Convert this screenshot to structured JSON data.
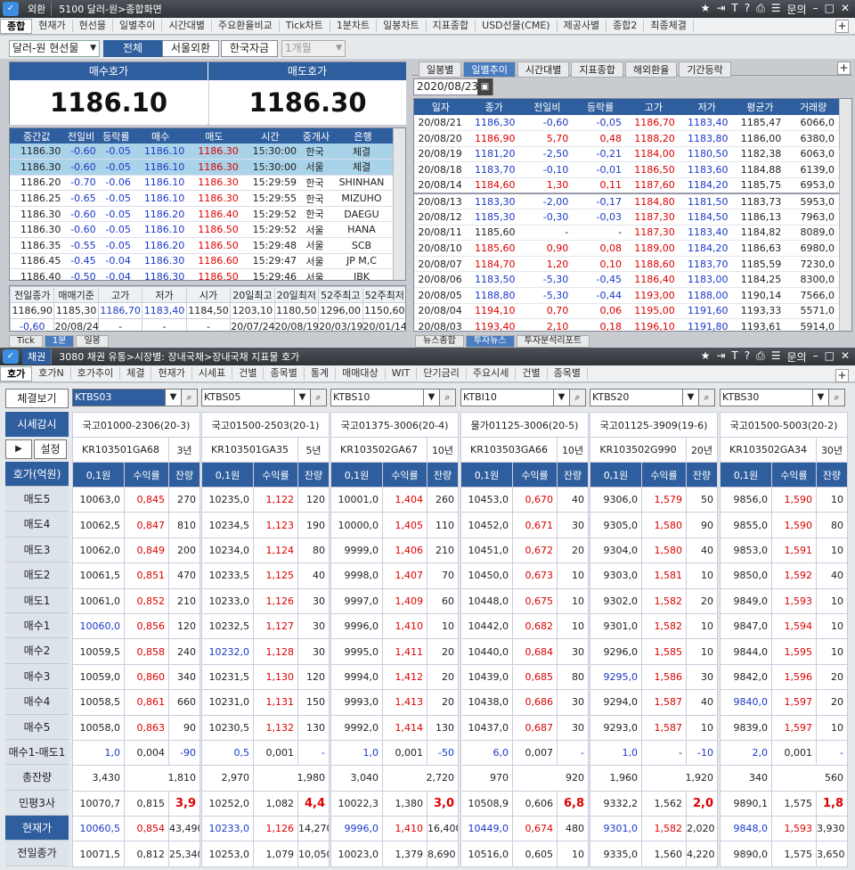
{
  "win1": {
    "icon": "외",
    "label": "외환",
    "title": "5100 달러-원>종합화면",
    "tabs": [
      "종합",
      "현재가",
      "현선물",
      "일별추이",
      "시간대별",
      "주요환율비교",
      "Tick차트",
      "1분차트",
      "일봉차트",
      "지표종합",
      "USD선물(CME)",
      "제공사별",
      "종합2",
      "최종체결"
    ],
    "selector": "달러-원 현선물",
    "btn_all": "전체",
    "btn_seoul": "서울외환",
    "btn_korea": "한국자금",
    "period": "1개월",
    "bid_label": "매수호가",
    "ask_label": "매도호가",
    "bid": "1186.10",
    "ask": "1186.30",
    "quote_headers": [
      "중간값",
      "전일비",
      "등락률",
      "매수",
      "매도",
      "시간",
      "중개사",
      "은행"
    ],
    "quotes": [
      [
        "1186.30",
        "-0.60",
        "-0.05",
        "1186.10",
        "1186.30",
        "15:30:00",
        "한국",
        "체결"
      ],
      [
        "1186.30",
        "-0.60",
        "-0.05",
        "1186.10",
        "1186.30",
        "15:30:00",
        "서울",
        "체결"
      ],
      [
        "1186.20",
        "-0.70",
        "-0.06",
        "1186.10",
        "1186.30",
        "15:29:59",
        "한국",
        "SHINHAN"
      ],
      [
        "1186.25",
        "-0.65",
        "-0.05",
        "1186.10",
        "1186.30",
        "15:29:55",
        "한국",
        "MIZUHO"
      ],
      [
        "1186.30",
        "-0.60",
        "-0.05",
        "1186.20",
        "1186.40",
        "15:29:52",
        "한국",
        "DAEGU"
      ],
      [
        "1186.30",
        "-0.60",
        "-0.05",
        "1186.10",
        "1186.50",
        "15:29:52",
        "서울",
        "HANA"
      ],
      [
        "1186.35",
        "-0.55",
        "-0.05",
        "1186.20",
        "1186.50",
        "15:29:48",
        "서울",
        "SCB"
      ],
      [
        "1186.45",
        "-0.45",
        "-0.04",
        "1186.30",
        "1186.60",
        "15:29:47",
        "서울",
        "JP M,C"
      ],
      [
        "1186.40",
        "-0.50",
        "-0.04",
        "1186.30",
        "1186.50",
        "15:29:46",
        "서울",
        "IBK"
      ]
    ],
    "summary_headers": [
      "전일종가",
      "매매기준",
      "고가",
      "저가",
      "시가",
      "20일최고",
      "20일최저",
      "52주최고",
      "52주최저"
    ],
    "summary_row1": [
      "1186,90",
      "1185,30",
      "1186,70",
      "1183,40",
      "1184,50",
      "1203,10",
      "1180,50",
      "1296,00",
      "1150,60"
    ],
    "summary_row2": [
      "-0,60",
      "20/08/24",
      "-",
      "-",
      "-",
      "20/07/24",
      "20/08/19",
      "20/03/19",
      "20/01/14"
    ],
    "right_tabs": [
      "일봉별",
      "일별추이",
      "시간대별",
      "지표종합",
      "해외환율",
      "기간등락"
    ],
    "date": "2020/08/23",
    "daily_headers": [
      "일자",
      "종가",
      "전일비",
      "등락률",
      "고가",
      "저가",
      "평균가",
      "거래량"
    ],
    "daily": [
      [
        "20/08/21",
        "1186,30",
        "-0,60",
        "-0,05",
        "1186,70",
        "1183,40",
        "1185,47",
        "6066,0"
      ],
      [
        "20/08/20",
        "1186,90",
        "5,70",
        "0,48",
        "1188,20",
        "1183,80",
        "1186,00",
        "6380,0"
      ],
      [
        "20/08/19",
        "1181,20",
        "-2,50",
        "-0,21",
        "1184,00",
        "1180,50",
        "1182,38",
        "6063,0"
      ],
      [
        "20/08/18",
        "1183,70",
        "-0,10",
        "-0,01",
        "1186,50",
        "1183,60",
        "1184,88",
        "6139,0"
      ],
      [
        "20/08/14",
        "1184,60",
        "1,30",
        "0,11",
        "1187,60",
        "1184,20",
        "1185,75",
        "6953,0"
      ],
      [
        "20/08/13",
        "1183,30",
        "-2,00",
        "-0,17",
        "1184,80",
        "1181,50",
        "1183,73",
        "5953,0"
      ],
      [
        "20/08/12",
        "1185,30",
        "-0,30",
        "-0,03",
        "1187,30",
        "1184,50",
        "1186,13",
        "7963,0"
      ],
      [
        "20/08/11",
        "1185,60",
        "-",
        "-",
        "1187,30",
        "1183,40",
        "1184,82",
        "8089,0"
      ],
      [
        "20/08/10",
        "1185,60",
        "0,90",
        "0,08",
        "1189,00",
        "1184,20",
        "1186,63",
        "6980,0"
      ],
      [
        "20/08/07",
        "1184,70",
        "1,20",
        "0,10",
        "1188,60",
        "1183,70",
        "1185,59",
        "7230,0"
      ],
      [
        "20/08/06",
        "1183,50",
        "-5,30",
        "-0,45",
        "1186,40",
        "1183,00",
        "1184,25",
        "8300,0"
      ],
      [
        "20/08/05",
        "1188,80",
        "-5,30",
        "-0,44",
        "1193,00",
        "1188,00",
        "1190,14",
        "7566,0"
      ],
      [
        "20/08/04",
        "1194,10",
        "0,70",
        "0,06",
        "1195,00",
        "1191,60",
        "1193,33",
        "5571,0"
      ],
      [
        "20/08/03",
        "1193,40",
        "2,10",
        "0,18",
        "1196,10",
        "1191,80",
        "1193,61",
        "5914,0"
      ]
    ],
    "bottom_left_tabs": [
      "Tick",
      "1분",
      "일봉"
    ],
    "bottom_right_tabs": [
      "뉴스종합",
      "투자뉴스",
      "투자분석리포트"
    ]
  },
  "win2": {
    "icon": "채권",
    "title": "3080 채권 유통>시장별: 장내국채>장내국채 지표물 호가",
    "tabs": [
      "호가",
      "호가N",
      "호가추이",
      "체결",
      "현재가",
      "시세표",
      "건별",
      "종목별",
      "통계",
      "매매대상",
      "WIT",
      "단기금리",
      "주요시세",
      "건별",
      "종목별"
    ],
    "trade_view": "체결보기",
    "auto_label": "시세감시",
    "setup": "설정",
    "side_labels": [
      "호가(억원)",
      "매도5",
      "매도4",
      "매도3",
      "매도2",
      "매도1",
      "매수1",
      "매수2",
      "매수3",
      "매수4",
      "매수5",
      "매수1-매도1",
      "총잔량",
      "민평3사",
      "현재가",
      "전일종가"
    ],
    "col_headers": [
      "0,1원",
      "수익률",
      "잔량"
    ],
    "bonds": [
      {
        "code": "KTBS03",
        "name": "국고01000-2306(20-3)",
        "isin": "KR103501GA68",
        "term": "3년",
        "asks": [
          [
            "10063,0",
            "0,845",
            "270"
          ],
          [
            "10062,5",
            "0,847",
            "810"
          ],
          [
            "10062,0",
            "0,849",
            "200"
          ],
          [
            "10061,5",
            "0,851",
            "470"
          ],
          [
            "10061,0",
            "0,852",
            "210"
          ]
        ],
        "bids": [
          [
            "10060,0",
            "0,856",
            "120"
          ],
          [
            "10059,5",
            "0,858",
            "240"
          ],
          [
            "10059,0",
            "0,860",
            "340"
          ],
          [
            "10058,5",
            "0,861",
            "660"
          ],
          [
            "10058,0",
            "0,863",
            "90"
          ]
        ],
        "diff": [
          "1,0",
          "0,004",
          "-90"
        ],
        "total": [
          "3,430",
          "1,810"
        ],
        "mp": [
          "10070,7",
          "0,815",
          "3,9"
        ],
        "cur": [
          "10060,5",
          "0,854",
          "43,490"
        ],
        "prev": [
          "10071,5",
          "0,812",
          "25,340"
        ]
      },
      {
        "code": "KTBS05",
        "name": "국고01500-2503(20-1)",
        "isin": "KR103501GA35",
        "term": "5년",
        "asks": [
          [
            "10235,0",
            "1,122",
            "120"
          ],
          [
            "10234,5",
            "1,123",
            "190"
          ],
          [
            "10234,0",
            "1,124",
            "80"
          ],
          [
            "10233,5",
            "1,125",
            "40"
          ],
          [
            "10233,0",
            "1,126",
            "30"
          ]
        ],
        "bids": [
          [
            "10232,5",
            "1,127",
            "30"
          ],
          [
            "10232,0",
            "1,128",
            "30"
          ],
          [
            "10231,5",
            "1,130",
            "120"
          ],
          [
            "10231,0",
            "1,131",
            "150"
          ],
          [
            "10230,5",
            "1,132",
            "130"
          ]
        ],
        "diff": [
          "0,5",
          "0,001",
          "-"
        ],
        "total": [
          "2,970",
          "1,980"
        ],
        "mp": [
          "10252,0",
          "1,082",
          "4,4"
        ],
        "cur": [
          "10233,0",
          "1,126",
          "14,270"
        ],
        "prev": [
          "10253,0",
          "1,079",
          "10,050"
        ]
      },
      {
        "code": "KTBS10",
        "name": "국고01375-3006(20-4)",
        "isin": "KR103502GA67",
        "term": "10년",
        "asks": [
          [
            "10001,0",
            "1,404",
            "260"
          ],
          [
            "10000,0",
            "1,405",
            "110"
          ],
          [
            "9999,0",
            "1,406",
            "210"
          ],
          [
            "9998,0",
            "1,407",
            "70"
          ],
          [
            "9997,0",
            "1,409",
            "60"
          ]
        ],
        "bids": [
          [
            "9996,0",
            "1,410",
            "10"
          ],
          [
            "9995,0",
            "1,411",
            "20"
          ],
          [
            "9994,0",
            "1,412",
            "20"
          ],
          [
            "9993,0",
            "1,413",
            "20"
          ],
          [
            "9992,0",
            "1,414",
            "130"
          ]
        ],
        "diff": [
          "1,0",
          "0,001",
          "-50"
        ],
        "total": [
          "3,040",
          "2,720"
        ],
        "mp": [
          "10022,3",
          "1,380",
          "3,0"
        ],
        "cur": [
          "9996,0",
          "1,410",
          "16,400"
        ],
        "prev": [
          "10023,0",
          "1,379",
          "8,690"
        ]
      },
      {
        "code": "KTBI10",
        "name": "물가01125-3006(20-5)",
        "isin": "KR103503GA66",
        "term": "10년",
        "asks": [
          [
            "10453,0",
            "0,670",
            "40"
          ],
          [
            "10452,0",
            "0,671",
            "30"
          ],
          [
            "10451,0",
            "0,672",
            "20"
          ],
          [
            "10450,0",
            "0,673",
            "10"
          ],
          [
            "10448,0",
            "0,675",
            "10"
          ]
        ],
        "bids": [
          [
            "10442,0",
            "0,682",
            "10"
          ],
          [
            "10440,0",
            "0,684",
            "30"
          ],
          [
            "10439,0",
            "0,685",
            "80"
          ],
          [
            "10438,0",
            "0,686",
            "30"
          ],
          [
            "10437,0",
            "0,687",
            "30"
          ]
        ],
        "diff": [
          "6,0",
          "0,007",
          "-"
        ],
        "total": [
          "970",
          "920"
        ],
        "mp": [
          "10508,9",
          "0,606",
          "6,8"
        ],
        "cur": [
          "10449,0",
          "0,674",
          "480"
        ],
        "prev": [
          "10516,0",
          "0,605",
          "10"
        ]
      },
      {
        "code": "KTBS20",
        "name": "국고01125-3909(19-6)",
        "isin": "KR103502G990",
        "term": "20년",
        "asks": [
          [
            "9306,0",
            "1,579",
            "50"
          ],
          [
            "9305,0",
            "1,580",
            "90"
          ],
          [
            "9304,0",
            "1,580",
            "40"
          ],
          [
            "9303,0",
            "1,581",
            "10"
          ],
          [
            "9302,0",
            "1,582",
            "20"
          ]
        ],
        "bids": [
          [
            "9301,0",
            "1,582",
            "10"
          ],
          [
            "9296,0",
            "1,585",
            "10"
          ],
          [
            "9295,0",
            "1,586",
            "30"
          ],
          [
            "9294,0",
            "1,587",
            "40"
          ],
          [
            "9293,0",
            "1,587",
            "10"
          ]
        ],
        "diff": [
          "1,0",
          "-",
          "-10"
        ],
        "total": [
          "1,960",
          "1,920"
        ],
        "mp": [
          "9332,2",
          "1,562",
          "2,0"
        ],
        "cur": [
          "9301,0",
          "1,582",
          "2,020"
        ],
        "prev": [
          "9335,0",
          "1,560",
          "4,220"
        ]
      },
      {
        "code": "KTBS30",
        "name": "국고01500-5003(20-2)",
        "isin": "KR103502GA34",
        "term": "30년",
        "asks": [
          [
            "9856,0",
            "1,590",
            "10"
          ],
          [
            "9855,0",
            "1,590",
            "80"
          ],
          [
            "9853,0",
            "1,591",
            "10"
          ],
          [
            "9850,0",
            "1,592",
            "40"
          ],
          [
            "9849,0",
            "1,593",
            "10"
          ]
        ],
        "bids": [
          [
            "9847,0",
            "1,594",
            "10"
          ],
          [
            "9844,0",
            "1,595",
            "10"
          ],
          [
            "9842,0",
            "1,596",
            "20"
          ],
          [
            "9840,0",
            "1,597",
            "20"
          ],
          [
            "9839,0",
            "1,597",
            "10"
          ]
        ],
        "diff": [
          "2,0",
          "0,001",
          "-"
        ],
        "total": [
          "340",
          "560"
        ],
        "mp": [
          "9890,1",
          "1,575",
          "1,8"
        ],
        "cur": [
          "9848,0",
          "1,593",
          "3,930"
        ],
        "prev": [
          "9890,0",
          "1,575",
          "3,650"
        ]
      }
    ]
  },
  "colors": {
    "accent": "#2f5e9e",
    "red": "#dd0000",
    "blue": "#1a38c8"
  }
}
